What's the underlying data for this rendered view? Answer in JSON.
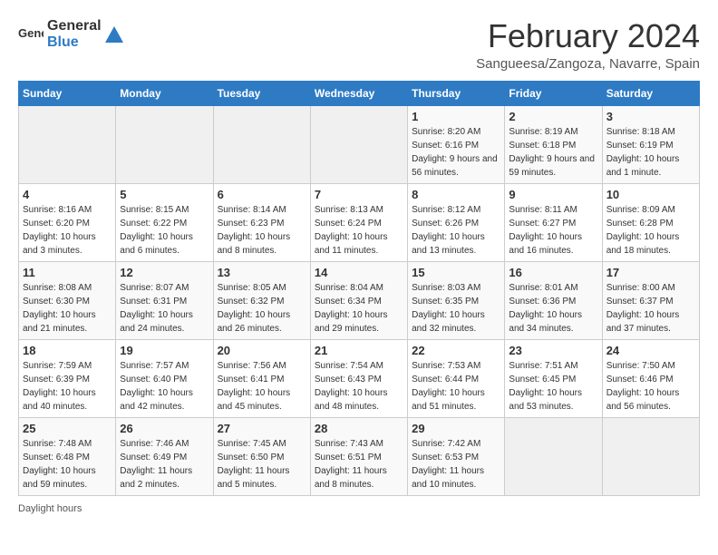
{
  "header": {
    "logo_general": "General",
    "logo_blue": "Blue",
    "title": "February 2024",
    "subtitle": "Sangueesa/Zangoza, Navarre, Spain"
  },
  "calendar": {
    "days_of_week": [
      "Sunday",
      "Monday",
      "Tuesday",
      "Wednesday",
      "Thursday",
      "Friday",
      "Saturday"
    ],
    "weeks": [
      [
        {
          "day": "",
          "info": ""
        },
        {
          "day": "",
          "info": ""
        },
        {
          "day": "",
          "info": ""
        },
        {
          "day": "",
          "info": ""
        },
        {
          "day": "1",
          "info": "Sunrise: 8:20 AM\nSunset: 6:16 PM\nDaylight: 9 hours and 56 minutes."
        },
        {
          "day": "2",
          "info": "Sunrise: 8:19 AM\nSunset: 6:18 PM\nDaylight: 9 hours and 59 minutes."
        },
        {
          "day": "3",
          "info": "Sunrise: 8:18 AM\nSunset: 6:19 PM\nDaylight: 10 hours and 1 minute."
        }
      ],
      [
        {
          "day": "4",
          "info": "Sunrise: 8:16 AM\nSunset: 6:20 PM\nDaylight: 10 hours and 3 minutes."
        },
        {
          "day": "5",
          "info": "Sunrise: 8:15 AM\nSunset: 6:22 PM\nDaylight: 10 hours and 6 minutes."
        },
        {
          "day": "6",
          "info": "Sunrise: 8:14 AM\nSunset: 6:23 PM\nDaylight: 10 hours and 8 minutes."
        },
        {
          "day": "7",
          "info": "Sunrise: 8:13 AM\nSunset: 6:24 PM\nDaylight: 10 hours and 11 minutes."
        },
        {
          "day": "8",
          "info": "Sunrise: 8:12 AM\nSunset: 6:26 PM\nDaylight: 10 hours and 13 minutes."
        },
        {
          "day": "9",
          "info": "Sunrise: 8:11 AM\nSunset: 6:27 PM\nDaylight: 10 hours and 16 minutes."
        },
        {
          "day": "10",
          "info": "Sunrise: 8:09 AM\nSunset: 6:28 PM\nDaylight: 10 hours and 18 minutes."
        }
      ],
      [
        {
          "day": "11",
          "info": "Sunrise: 8:08 AM\nSunset: 6:30 PM\nDaylight: 10 hours and 21 minutes."
        },
        {
          "day": "12",
          "info": "Sunrise: 8:07 AM\nSunset: 6:31 PM\nDaylight: 10 hours and 24 minutes."
        },
        {
          "day": "13",
          "info": "Sunrise: 8:05 AM\nSunset: 6:32 PM\nDaylight: 10 hours and 26 minutes."
        },
        {
          "day": "14",
          "info": "Sunrise: 8:04 AM\nSunset: 6:34 PM\nDaylight: 10 hours and 29 minutes."
        },
        {
          "day": "15",
          "info": "Sunrise: 8:03 AM\nSunset: 6:35 PM\nDaylight: 10 hours and 32 minutes."
        },
        {
          "day": "16",
          "info": "Sunrise: 8:01 AM\nSunset: 6:36 PM\nDaylight: 10 hours and 34 minutes."
        },
        {
          "day": "17",
          "info": "Sunrise: 8:00 AM\nSunset: 6:37 PM\nDaylight: 10 hours and 37 minutes."
        }
      ],
      [
        {
          "day": "18",
          "info": "Sunrise: 7:59 AM\nSunset: 6:39 PM\nDaylight: 10 hours and 40 minutes."
        },
        {
          "day": "19",
          "info": "Sunrise: 7:57 AM\nSunset: 6:40 PM\nDaylight: 10 hours and 42 minutes."
        },
        {
          "day": "20",
          "info": "Sunrise: 7:56 AM\nSunset: 6:41 PM\nDaylight: 10 hours and 45 minutes."
        },
        {
          "day": "21",
          "info": "Sunrise: 7:54 AM\nSunset: 6:43 PM\nDaylight: 10 hours and 48 minutes."
        },
        {
          "day": "22",
          "info": "Sunrise: 7:53 AM\nSunset: 6:44 PM\nDaylight: 10 hours and 51 minutes."
        },
        {
          "day": "23",
          "info": "Sunrise: 7:51 AM\nSunset: 6:45 PM\nDaylight: 10 hours and 53 minutes."
        },
        {
          "day": "24",
          "info": "Sunrise: 7:50 AM\nSunset: 6:46 PM\nDaylight: 10 hours and 56 minutes."
        }
      ],
      [
        {
          "day": "25",
          "info": "Sunrise: 7:48 AM\nSunset: 6:48 PM\nDaylight: 10 hours and 59 minutes."
        },
        {
          "day": "26",
          "info": "Sunrise: 7:46 AM\nSunset: 6:49 PM\nDaylight: 11 hours and 2 minutes."
        },
        {
          "day": "27",
          "info": "Sunrise: 7:45 AM\nSunset: 6:50 PM\nDaylight: 11 hours and 5 minutes."
        },
        {
          "day": "28",
          "info": "Sunrise: 7:43 AM\nSunset: 6:51 PM\nDaylight: 11 hours and 8 minutes."
        },
        {
          "day": "29",
          "info": "Sunrise: 7:42 AM\nSunset: 6:53 PM\nDaylight: 11 hours and 10 minutes."
        },
        {
          "day": "",
          "info": ""
        },
        {
          "day": "",
          "info": ""
        }
      ]
    ],
    "footer_note": "Daylight hours"
  }
}
